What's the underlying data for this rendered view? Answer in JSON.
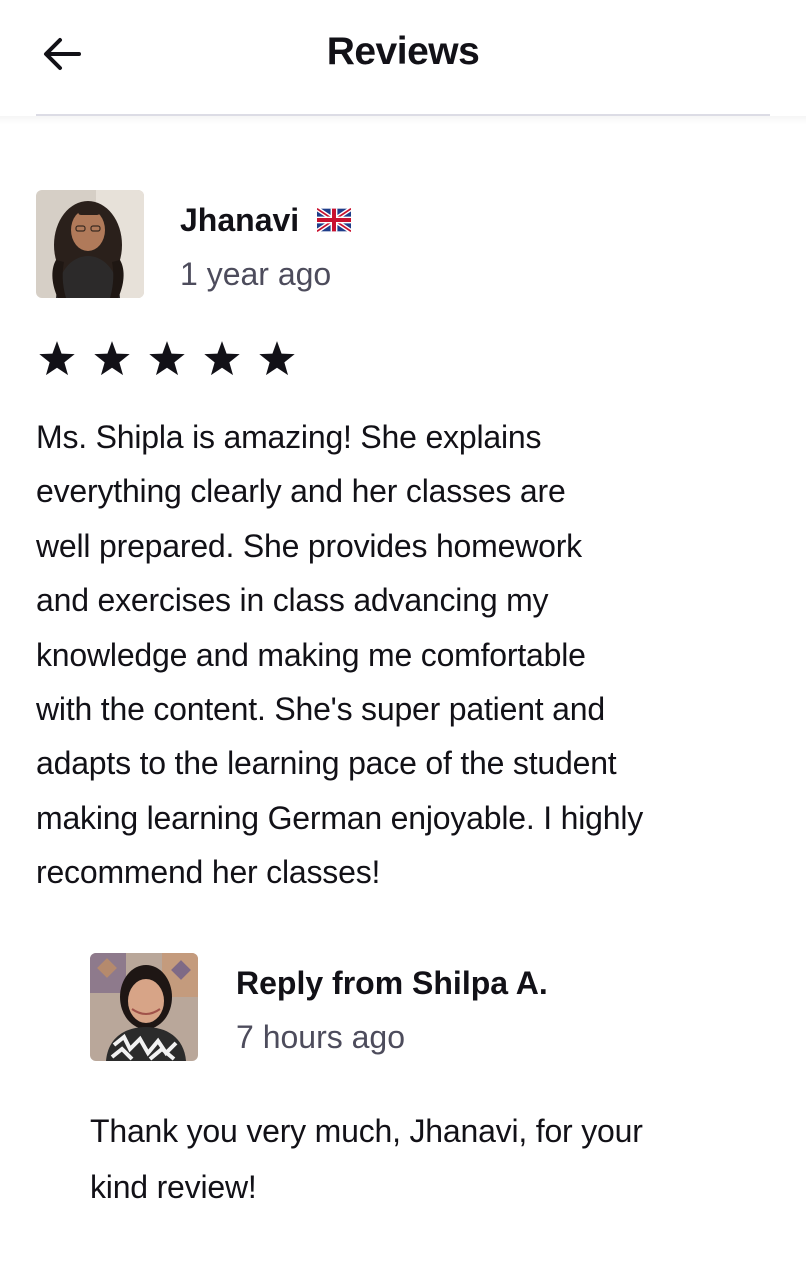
{
  "header": {
    "title": "Reviews",
    "back_icon": "arrow-left-icon"
  },
  "review": {
    "reviewer_name": "Jhanavi",
    "country_flag": "uk-flag-icon",
    "date": "1 year ago",
    "rating": 5,
    "rating_max": 5,
    "text": "Ms. Shipla is amazing! She explains\neverything clearly and her classes are\nwell prepared. She provides homework\nand exercises in class advancing my\nknowledge and making me comfortable\nwith the content. She's super patient and\nadapts to the learning pace of the student\nmaking learning German enjoyable. I highly\nrecommend  her classes!"
  },
  "reply": {
    "from": "Reply from Shilpa A.",
    "date": "7 hours ago",
    "text": "Thank you very much, Jhanavi, for your\nkind review!"
  },
  "colors": {
    "text_primary": "#121117",
    "text_secondary": "#4d4c5c",
    "divider": "#dcdce5",
    "star": "#121117"
  }
}
